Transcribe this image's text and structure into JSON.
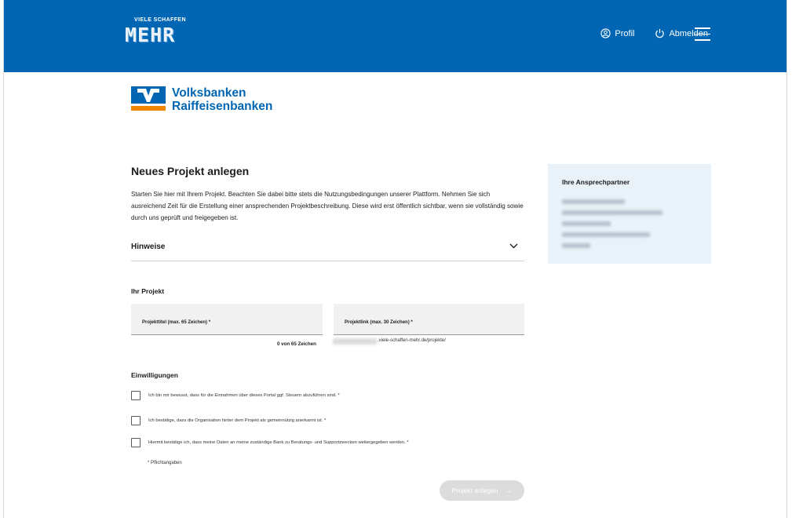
{
  "header": {
    "logo_small": "VIELE SCHAFFEN",
    "logo_big": "MEHR",
    "nav": [
      {
        "label": "Profil",
        "icon": "user-circle-icon"
      },
      {
        "label": "Abmelden",
        "icon": "power-icon"
      }
    ],
    "menu_icon": "hamburger-menu-icon",
    "bg_color": "#0066b3"
  },
  "bank_logo": {
    "line1": "Volksbanken",
    "line2": "Raiffeisenbanken",
    "blue": "#0066b3",
    "orange": "#f18400"
  },
  "main": {
    "title": "Neues Projekt anlegen",
    "intro": "Starten Sie hier mit Ihrem Projekt. Beachten Sie dabei bitte stets die Nutzungsbedingungen unserer Plattform. Nehmen Sie sich ausreichend Zeit für die Erstellung einer ansprechenden Projektbeschreibung. Diese wird erst öffentlich sichtbar, wenn sie vollständig sowie durch uns geprüft und freigegeben ist.",
    "hinweise_label": "Hinweise",
    "project_section_title": "Ihr Projekt",
    "fields": {
      "title_label": "Projekttitel (max. 65 Zeichen) *",
      "title_counter": "0 von 65 Zeichen",
      "link_label": "Projektlink (max. 30 Zeichen) *",
      "link_suffix": ".viele-schaffen-mehr.de/projekte/"
    },
    "consent_title": "Einwilligungen",
    "consents": [
      "Ich bin mir bewusst, dass für die Einnahmen über dieses Portal ggf. Steuern abzuführen sind. *",
      "Ich bestätige, dass die Organisation hinter dem Projekt als gemeinnützig anerkannt ist. *",
      "Hiermit bestätige ich, dass meine Daten an meine zuständige Bank zu Beratungs- und Supportzwecken weitergegeben werden. *"
    ],
    "required_note": "* Pflichtangaben",
    "submit_label": "Projekt anlegen",
    "submit_arrow": "→"
  },
  "sidebar": {
    "title": "Ihre Ansprechpartner"
  }
}
